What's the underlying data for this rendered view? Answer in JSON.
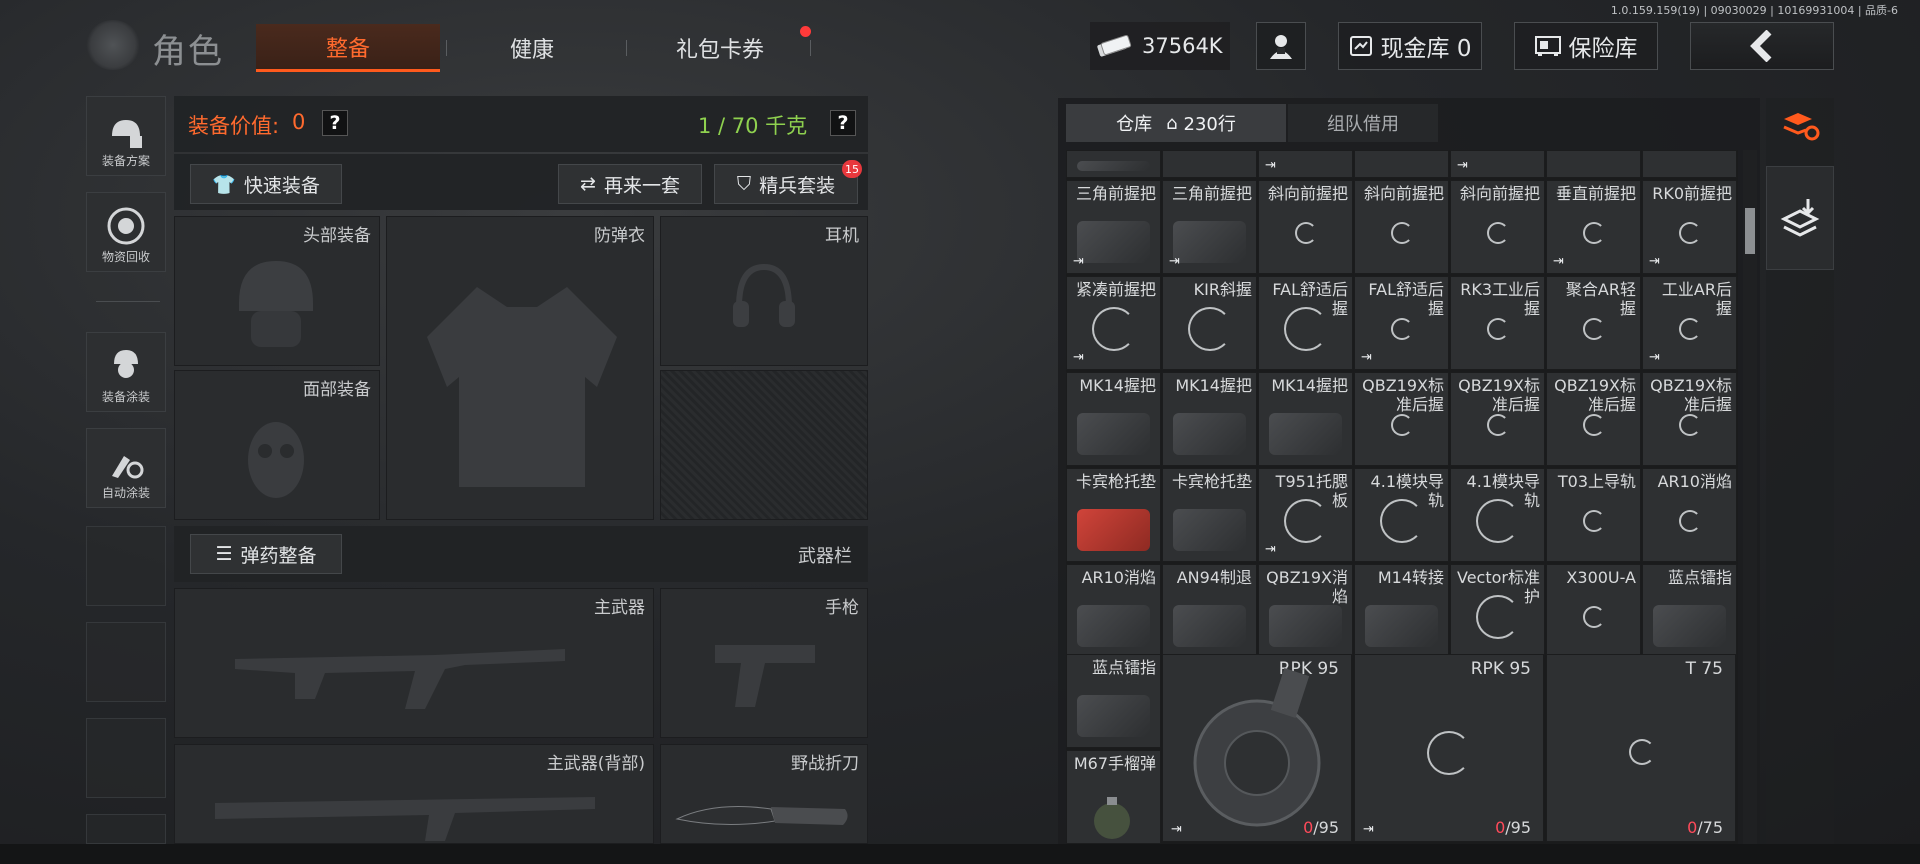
{
  "version": "1.0.159.159(19) | 09030029 | 10169931004 | 品质-6",
  "header": {
    "title": "角色",
    "tabs": [
      {
        "label": "整备",
        "active": true
      },
      {
        "label": "健康",
        "active": false
      },
      {
        "label": "礼包卡券",
        "active": false,
        "badge": true
      }
    ],
    "money": "37564K",
    "cash_vault": "现金库 0",
    "safe_vault": "保险库"
  },
  "sidebar": [
    {
      "label": "装备方案",
      "icon": "helmet-plan-icon"
    },
    {
      "label": "物资回收",
      "icon": "recycle-icon"
    },
    {
      "label": "装备涂装",
      "icon": "soldier-paint-icon"
    },
    {
      "label": "自动涂装",
      "icon": "brush-gear-icon"
    }
  ],
  "loadout": {
    "value_label": "装备价值:",
    "value": "0",
    "weight": "1 / 70 千克",
    "quick_equip": "快速装备",
    "again": "再来一套",
    "elite": "精兵套装",
    "elite_badge": "15",
    "ammo": "弹药整备",
    "weapon_bar": "武器栏",
    "slots": {
      "head": "头部装备",
      "vest": "防弹衣",
      "headset": "耳机",
      "face": "面部装备",
      "primary": "主武器",
      "pistol": "手枪",
      "primary_back": "主武器(背部)",
      "knife": "野战折刀"
    }
  },
  "warehouse": {
    "tab_storage": "仓库",
    "tab_rows": "230行",
    "tab_team": "组队借用",
    "rows": [
      [
        "三角前握把",
        "三角前握把",
        "斜向前握把",
        "斜向前握把",
        "斜向前握把",
        "垂直前握把",
        "RK0前握把"
      ],
      [
        "紧凑前握把",
        "KIR斜握",
        "FAL舒适后握",
        "FAL舒适后握",
        "RK3工业后握",
        "聚合AR轻握",
        "工业AR后握"
      ],
      [
        "MK14握把",
        "MK14握把",
        "MK14握把",
        "QBZ19X标准后握",
        "QBZ19X标准后握",
        "QBZ19X标准后握",
        "QBZ19X标准后握"
      ],
      [
        "卡宾枪托垫",
        "卡宾枪托垫",
        "T951托腮板",
        "4.1模块导轨",
        "4.1模块导轨",
        "T03上导轨",
        "AR10消焰"
      ],
      [
        "AR10消焰",
        "AN94制退",
        "QBZ19X消焰",
        "M14转接",
        "Vector标准护",
        "X300U-A",
        "蓝点镭指"
      ]
    ],
    "small_left": [
      "蓝点镭指",
      "M67手榴弹"
    ],
    "big": [
      {
        "name": "RPK 95",
        "count_red": "0",
        "count_max": "/95"
      },
      {
        "name": "RPK 95",
        "count_red": "0",
        "count_max": "/95"
      },
      {
        "name": "T 75",
        "count_red": "0",
        "count_max": "/75"
      }
    ]
  }
}
